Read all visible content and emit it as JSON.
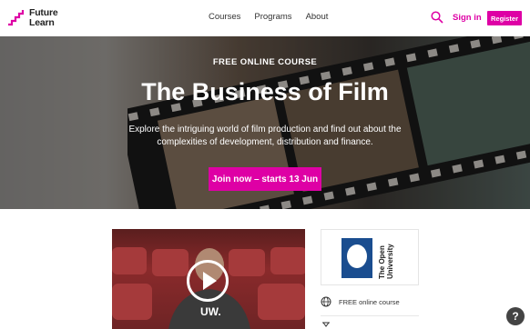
{
  "header": {
    "logo_line1": "Future",
    "logo_line2": "Learn",
    "nav": [
      "Courses",
      "Programs",
      "About"
    ],
    "signin": "Sign in",
    "register": "Register"
  },
  "hero": {
    "kicker": "FREE ONLINE COURSE",
    "title": "The Business of Film",
    "description": "Explore the intriguing world of film production and find out about the complexities of development, distribution and finance.",
    "cta": "Join now – starts 13 Jun"
  },
  "video": {
    "shirt_text": "UW."
  },
  "partner": {
    "name_line1": "The Open",
    "name_line2": "University"
  },
  "features": [
    {
      "icon": "globe-icon",
      "label": "FREE online course"
    },
    {
      "icon": "hourglass-icon",
      "label": ""
    }
  ],
  "help": {
    "label": "?"
  },
  "colors": {
    "brand": "#de00a5"
  }
}
